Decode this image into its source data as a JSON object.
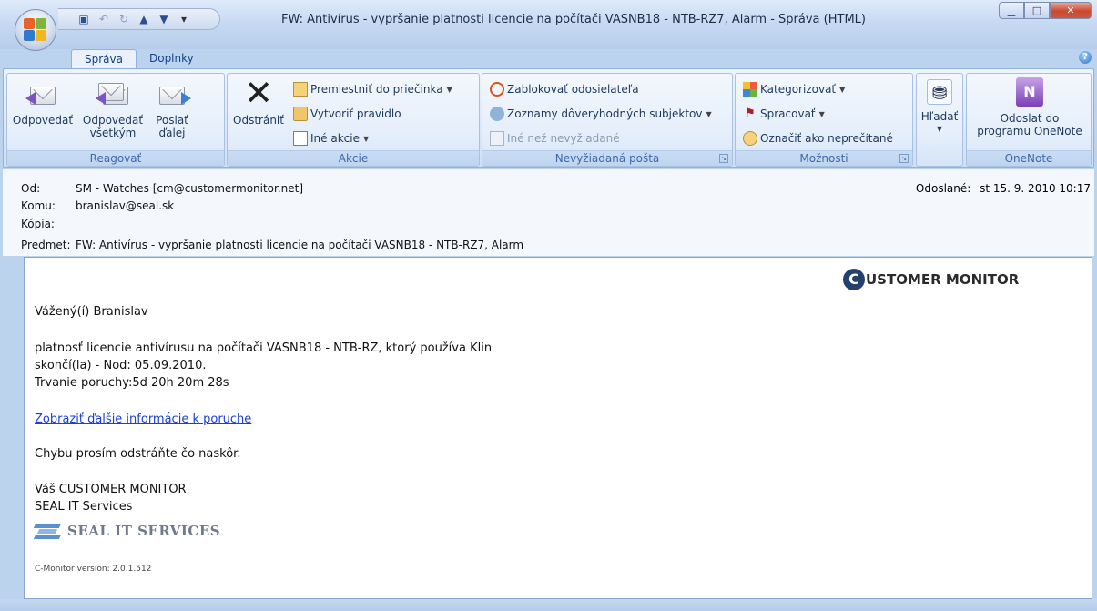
{
  "window": {
    "title": "FW: Antivírus - vypršanie platnosti licencie na počítači VASNB18 - NTB-RZ7, Alarm - Správa (HTML)"
  },
  "tabs": [
    {
      "label": "Správa",
      "active": true
    },
    {
      "label": "Doplnky",
      "active": false
    }
  ],
  "ribbon": {
    "reagovat": {
      "label": "Reagovať",
      "reply": [
        "Odpovedať",
        ""
      ],
      "reply_all": [
        "Odpovedať",
        "všetkým"
      ],
      "forward": [
        "Poslať",
        "ďalej"
      ]
    },
    "akcie": {
      "label": "Akcie",
      "delete": "Odstrániť",
      "move": "Premiestniť do priečinka",
      "rule": "Vytvoriť pravidlo",
      "other": "Iné akcie"
    },
    "junk": {
      "label": "Nevyžiadaná pošta",
      "block": "Zablokovať odosielateľa",
      "safe_lists": "Zoznamy dôveryhodných subjektov",
      "not_junk": "Iné než nevyžiadané"
    },
    "options": {
      "label": "Možnosti",
      "categorize": "Kategorizovať",
      "follow_up": "Spracovať",
      "mark_unread": "Označiť ako neprečítané"
    },
    "find": {
      "label": "Hľadať"
    },
    "onenote": {
      "label": "OneNote",
      "send": [
        "Odoslať do",
        "programu OneNote"
      ]
    }
  },
  "header": {
    "from_label": "Od:",
    "from": "SM - Watches [cm@customermonitor.net]",
    "to_label": "Komu:",
    "to": "branislav@seal.sk",
    "cc_label": "Kópia:",
    "cc": "",
    "subject_label": "Predmet:",
    "subject": "FW: Antivírus - vypršanie platnosti licencie na počítači VASNB18 - NTB-RZ7, Alarm",
    "sent_label": "Odoslané:",
    "sent": "st 15. 9. 2010 10:17"
  },
  "message": {
    "logo_letter": "C",
    "logo_text": "USTOMER MONITOR",
    "greeting": "Vážený(í) Branislav",
    "line1": "platnosť licencie antivírusu na počítači VASNB18 - NTB-RZ, ktorý používa Klin",
    "line2": "skončí(la) - Nod: 05.09.2010.",
    "line3_label": "Trvanie poruchy:",
    "line3_value": "5d 20h 20m 28s",
    "link": "Zobraziť ďalšie informácie k poruche",
    "request": "Chybu prosím odstráňte čo naskôr.",
    "sig1": "Váš CUSTOMER MONITOR",
    "sig2": "SEAL IT Services",
    "seal_logo": "SEAL IT SERVICES",
    "version": "C-Monitor version: 2.0.1.512"
  },
  "colors": {
    "accent": "#15428b",
    "link": "#1a3fd6",
    "close": "#c9492f"
  }
}
